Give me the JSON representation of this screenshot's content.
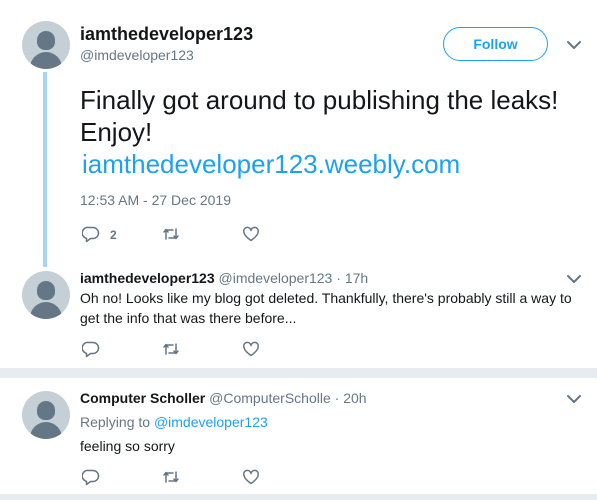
{
  "main_tweet": {
    "display_name": "iamthedeveloper123",
    "handle": "@imdeveloper123",
    "follow_label": "Follow",
    "text": "Finally got around to publishing the leaks!  Enjoy!",
    "link": "iamthedeveloper123.weebly.com",
    "timestamp": "12:53 AM - 27 Dec 2019",
    "reply_count": "2"
  },
  "reply1": {
    "display_name": "iamthedeveloper123",
    "handle": "@imdeveloper123",
    "dot": "·",
    "time": "17h",
    "text": "Oh no!  Looks like my blog got deleted.  Thankfully, there's probably still a way to get the info that was there before..."
  },
  "reply2": {
    "display_name": "Computer Scholler",
    "handle": "@ComputerScholle",
    "dot": "·",
    "time": "20h",
    "replying_prefix": "Replying to",
    "replying_to": "@imdeveloper123",
    "text": "feeling so sorry"
  },
  "icons": [
    "avatar-icon",
    "chevron-down-icon",
    "reply-icon",
    "retweet-icon",
    "like-icon"
  ],
  "colors": {
    "accent": "#1da1f2",
    "muted": "#657786",
    "thread_line": "#a5d5f2",
    "text": "#14171a"
  }
}
